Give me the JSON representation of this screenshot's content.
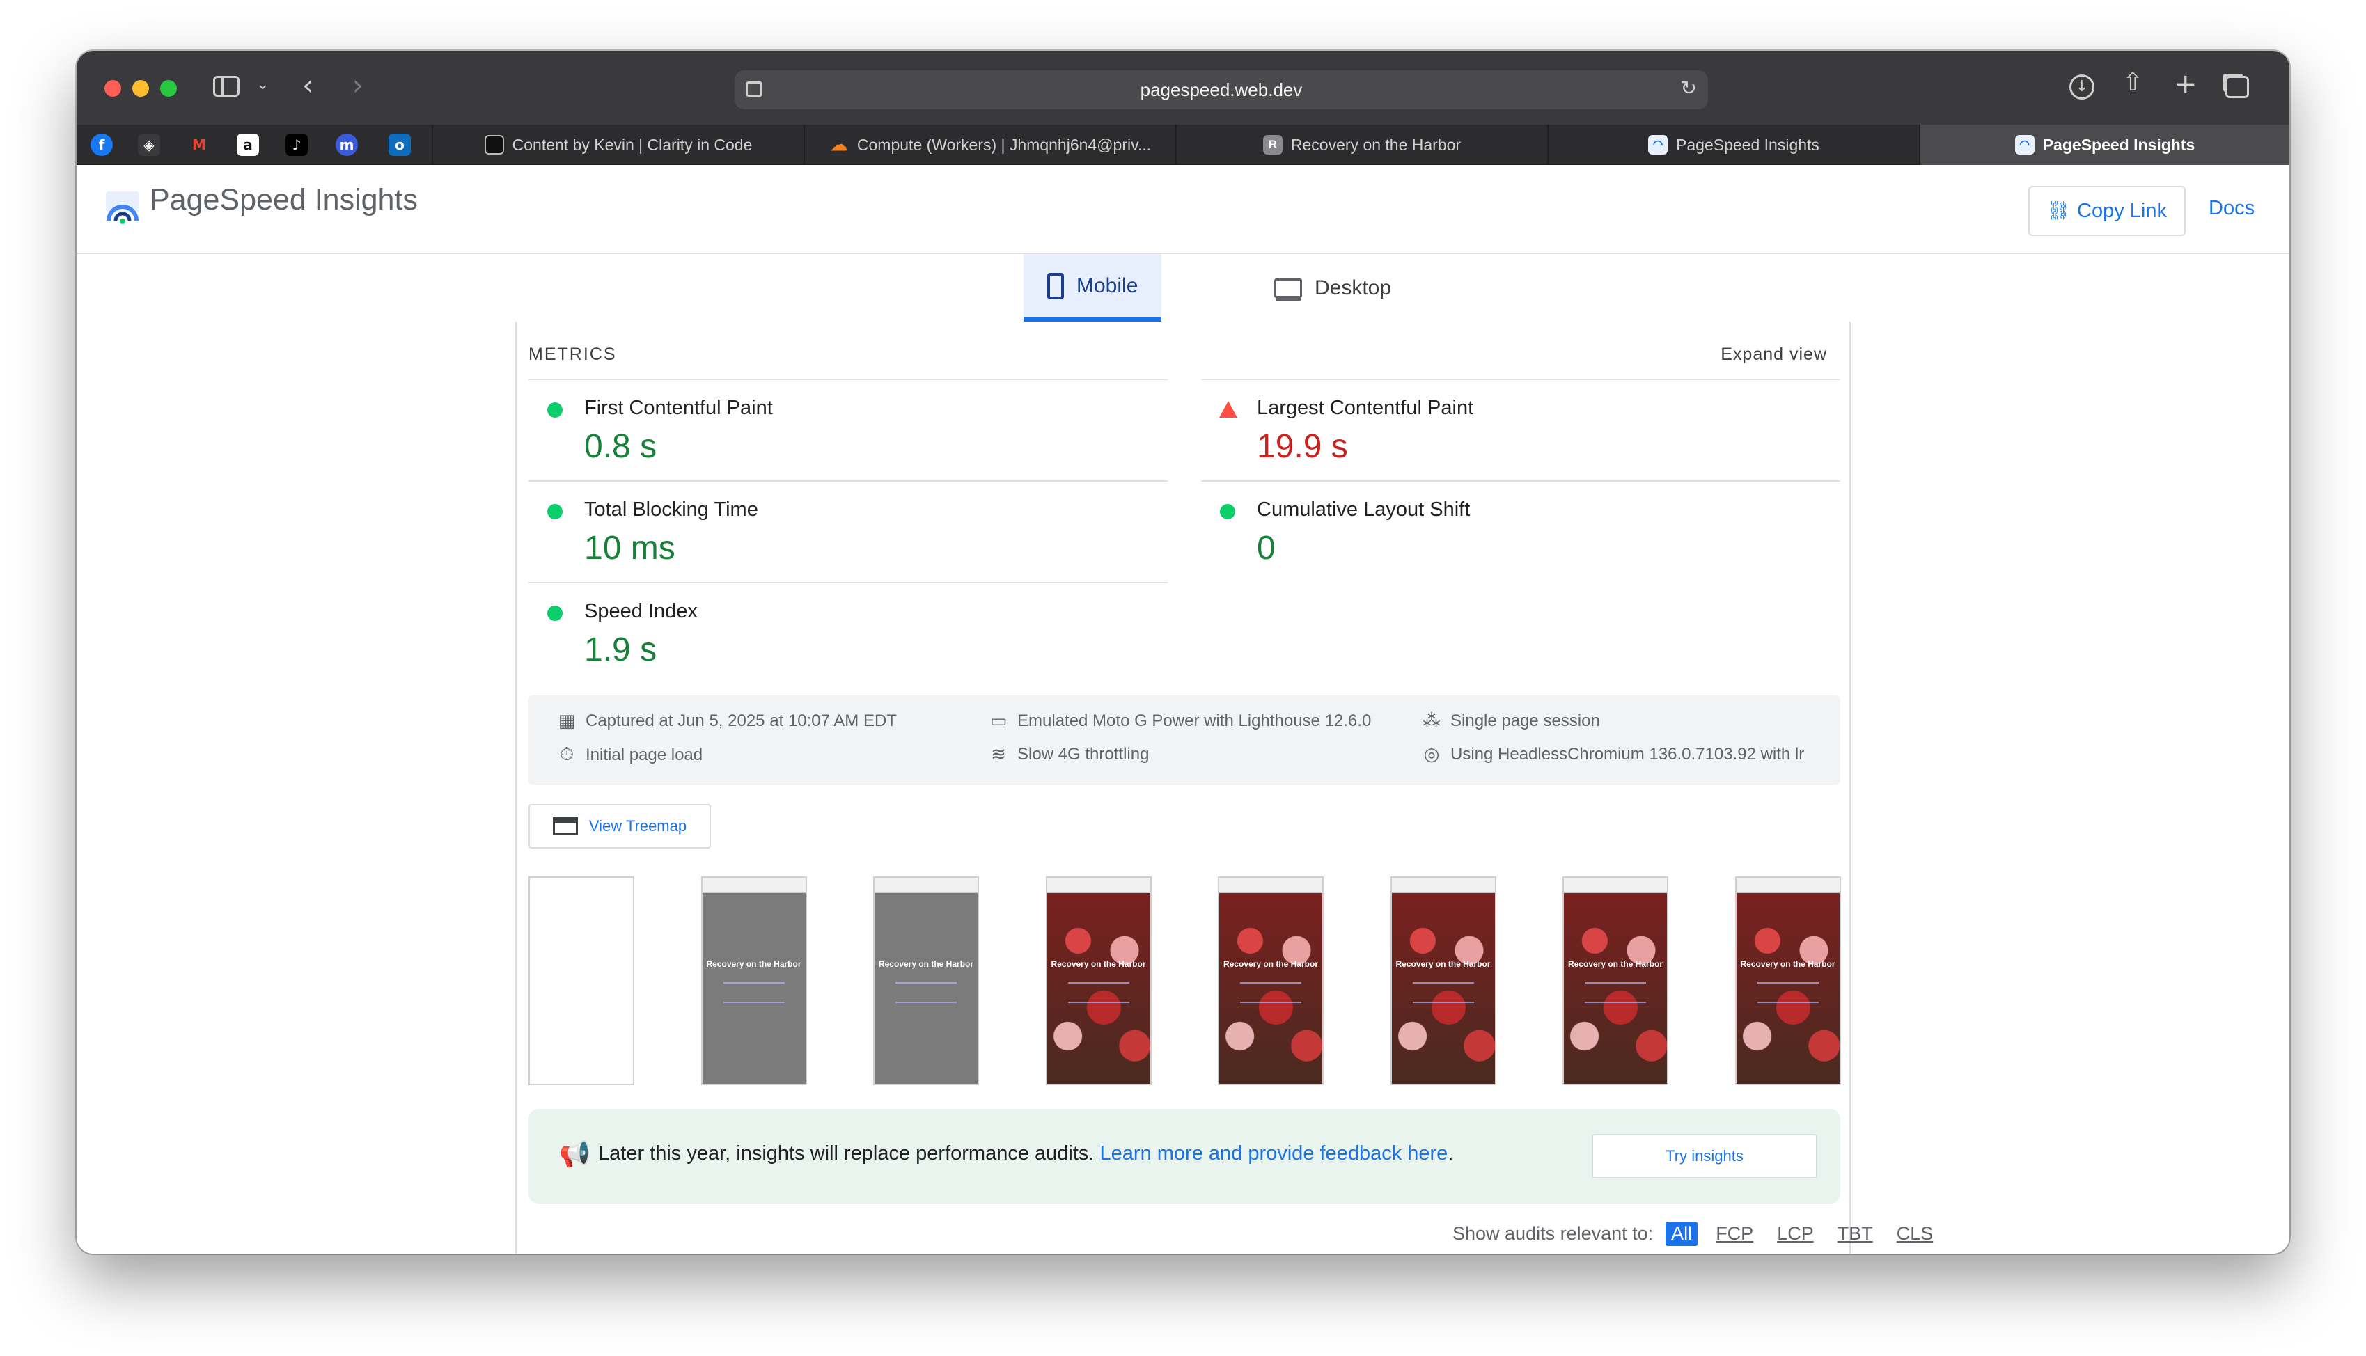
{
  "browser": {
    "url": "pagespeed.web.dev",
    "pinned_tabs": [
      {
        "icon": "facebook-icon",
        "glyph": "f",
        "color": "#1877f2"
      },
      {
        "icon": "shield-icon",
        "glyph": "◈",
        "color": "#3a3a3c"
      },
      {
        "icon": "gmail-icon",
        "glyph": "M",
        "color": "#ea4335"
      },
      {
        "icon": "amazon-icon",
        "glyph": "a",
        "color": "#111111"
      },
      {
        "icon": "tiktok-icon",
        "glyph": "♪",
        "color": "#000000"
      },
      {
        "icon": "app-icon",
        "glyph": "m",
        "color": "#3b5bdb"
      },
      {
        "icon": "outlook-icon",
        "glyph": "o",
        "color": "#0f6cbd"
      }
    ],
    "tabs": [
      {
        "label": "Content by Kevin | Clarity in Code",
        "icon": "document-icon"
      },
      {
        "label": "Compute (Workers) | Jhmqnhj6n4@priv...",
        "icon": "cloudflare-icon"
      },
      {
        "label": "Recovery on the Harbor",
        "icon": "r-icon",
        "glyph": "R"
      },
      {
        "label": "PageSpeed Insights",
        "icon": "pagespeed-icon"
      },
      {
        "label": "PageSpeed Insights",
        "icon": "pagespeed-icon"
      }
    ]
  },
  "header": {
    "title": "PageSpeed Insights",
    "copy_link": "Copy Link",
    "docs": "Docs"
  },
  "device_tabs": {
    "mobile": "Mobile",
    "desktop": "Desktop",
    "selected": "Mobile"
  },
  "metrics": {
    "heading": "METRICS",
    "expand": "Expand view",
    "items": [
      {
        "label": "First Contentful Paint",
        "value": "0.8 s",
        "status": "good"
      },
      {
        "label": "Largest Contentful Paint",
        "value": "19.9 s",
        "status": "poor"
      },
      {
        "label": "Total Blocking Time",
        "value": "10 ms",
        "status": "good"
      },
      {
        "label": "Cumulative Layout Shift",
        "value": "0",
        "status": "good"
      },
      {
        "label": "Speed Index",
        "value": "1.9 s",
        "status": "good"
      }
    ]
  },
  "meta": {
    "captured": "Captured at Jun 5, 2025 at 10:07 AM EDT",
    "initial_load": "Initial page load",
    "device": "Emulated Moto G Power with Lighthouse 12.6.0",
    "throttling": "Slow 4G throttling",
    "session": "Single page session",
    "browser": "Using HeadlessChromium 136.0.7103.92 with lr"
  },
  "treemap_button": "View Treemap",
  "filmstrip": {
    "frames": [
      {
        "style": "blank"
      },
      {
        "style": "gray",
        "title": "Recovery on the Harbor"
      },
      {
        "style": "gray",
        "title": "Recovery on the Harbor"
      },
      {
        "style": "red",
        "title": "Recovery on the Harbor"
      },
      {
        "style": "red",
        "title": "Recovery on the Harbor"
      },
      {
        "style": "red",
        "title": "Recovery on the Harbor"
      },
      {
        "style": "red",
        "title": "Recovery on the Harbor"
      },
      {
        "style": "red",
        "title": "Recovery on the Harbor"
      }
    ]
  },
  "banner": {
    "text": "Later this year, insights will replace performance audits.",
    "link": "Learn more and provide feedback here",
    "period": ".",
    "button": "Try insights"
  },
  "filters": {
    "label": "Show audits relevant to:",
    "options": [
      "All",
      "FCP",
      "LCP",
      "TBT",
      "CLS"
    ],
    "selected": "All"
  },
  "colors": {
    "good": "#188038",
    "poor": "#c5221f",
    "accent": "#1a73e8"
  }
}
